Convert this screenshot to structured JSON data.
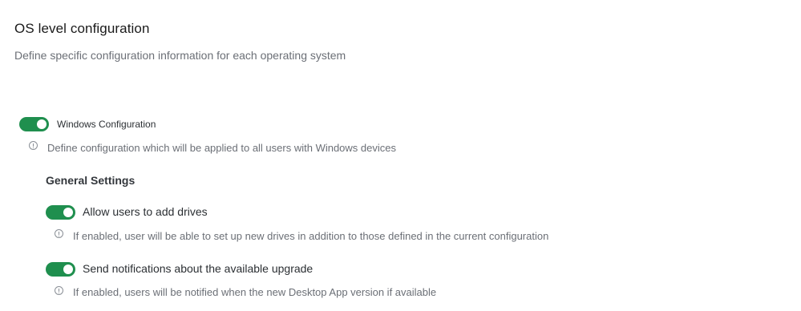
{
  "header": {
    "title": "OS level configuration",
    "subtitle": "Define specific configuration information for each operating system"
  },
  "windows": {
    "toggle_on": true,
    "label": "Windows Configuration",
    "hint": "Define configuration which will be applied to all users with Windows devices",
    "icon": "info-icon"
  },
  "general": {
    "title": "General Settings",
    "settings": [
      {
        "toggle_on": true,
        "label": "Allow users to add drives",
        "hint": "If enabled, user will be able to set up new drives in addition to those defined in the current configuration"
      },
      {
        "toggle_on": true,
        "label": "Send notifications about the available upgrade",
        "hint": "If enabled, users will be notified when the new Desktop App version if available"
      }
    ]
  },
  "colors": {
    "toggle_on": "#1f8f4e",
    "muted_text": "#6b6f76"
  }
}
